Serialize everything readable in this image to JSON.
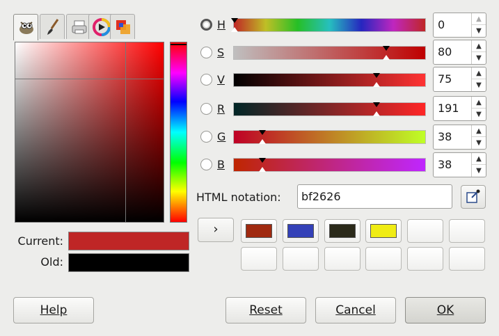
{
  "selector_tabs": [
    {
      "icon": "gimp-wilber-icon",
      "active": true
    },
    {
      "icon": "paintbrush-icon",
      "active": false
    },
    {
      "icon": "printer-cmyk-icon",
      "active": false
    },
    {
      "icon": "color-wheel-icon",
      "active": false
    },
    {
      "icon": "palette-watercolor-icon",
      "active": false
    }
  ],
  "swatches": {
    "current_label": "Current:",
    "current_color": "#bf2626",
    "old_label": "Old:",
    "old_color": "#000000"
  },
  "channels": [
    {
      "id": "H",
      "label": "H",
      "value": "0",
      "selected": true
    },
    {
      "id": "S",
      "label": "S",
      "value": "80",
      "selected": false
    },
    {
      "id": "V",
      "label": "V",
      "value": "75",
      "selected": false
    },
    {
      "id": "R",
      "label": "R",
      "value": "191",
      "selected": false
    },
    {
      "id": "G",
      "label": "G",
      "value": "38",
      "selected": false
    },
    {
      "id": "B",
      "label": "B",
      "value": "38",
      "selected": false
    }
  ],
  "html_notation": {
    "label": "HTML notation:",
    "value": "bf2626"
  },
  "history": {
    "arrow": "›",
    "colors": [
      "#a02a10",
      "#3441b8",
      "#2b2a1a",
      "#f0ec14",
      "#ffffff",
      "#ffffff",
      "#ffffff",
      "#ffffff",
      "#ffffff",
      "#ffffff",
      "#ffffff",
      "#ffffff"
    ]
  },
  "buttons": {
    "help": "Help",
    "reset": "Reset",
    "cancel": "Cancel",
    "ok": "OK"
  }
}
